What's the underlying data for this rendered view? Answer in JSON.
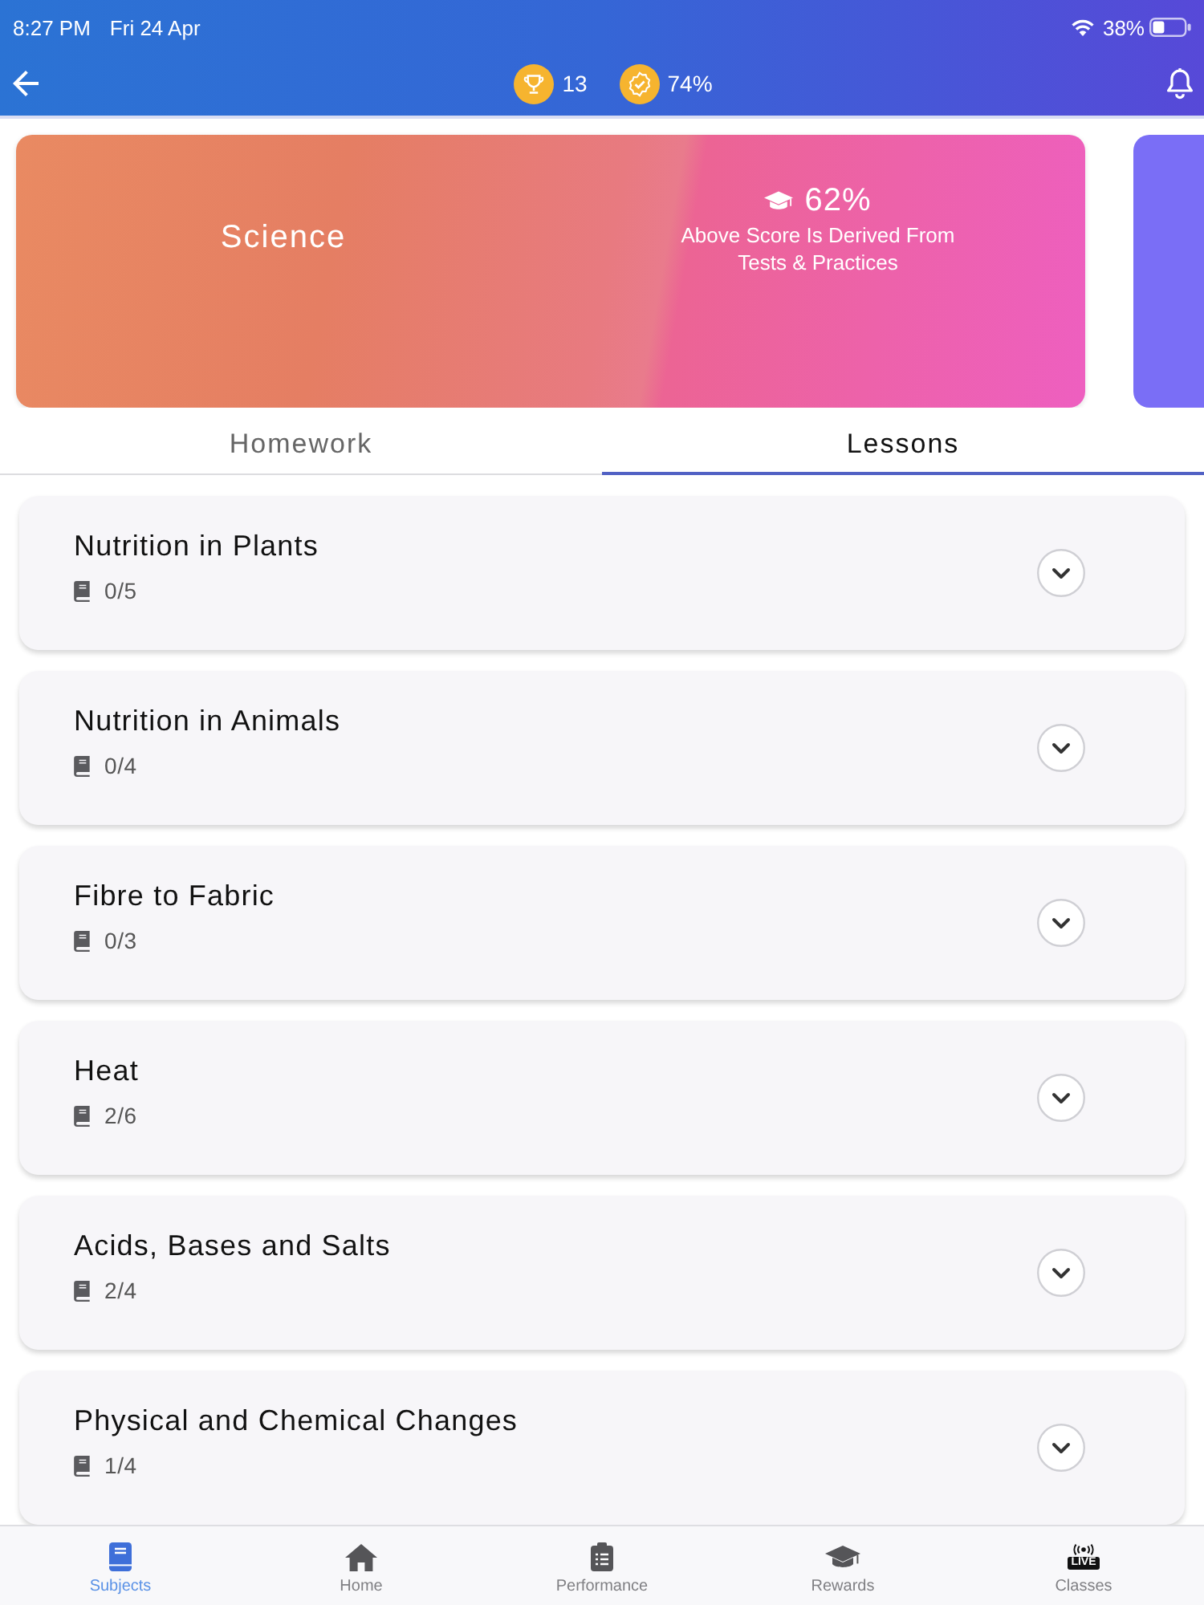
{
  "status_bar": {
    "time": "8:27 PM",
    "date": "Fri 24 Apr",
    "battery": "38%"
  },
  "header": {
    "trophies": "13",
    "score": "74%"
  },
  "carousel": {
    "cards": [
      {
        "title": "Science",
        "score": "62%",
        "note": "Above Score Is Derived From Tests & Practices"
      }
    ],
    "has_next": true
  },
  "tabs": [
    {
      "label": "Homework",
      "selected": false
    },
    {
      "label": "Lessons",
      "selected": true
    }
  ],
  "lessons": [
    {
      "title": "Nutrition in Plants",
      "progress": "0/5",
      "expanded": false
    },
    {
      "title": "Nutrition in Animals",
      "progress": "0/4",
      "expanded": false
    },
    {
      "title": "Fibre to Fabric",
      "progress": "0/3",
      "expanded": false
    },
    {
      "title": "Heat",
      "progress": "2/6",
      "expanded": false
    },
    {
      "title": "Acids, Bases and Salts",
      "progress": "2/4",
      "expanded": false
    },
    {
      "title": "Physical and Chemical Changes",
      "progress": "1/4",
      "expanded": false
    }
  ],
  "bottom_nav": [
    {
      "label": "Subjects",
      "selected": true
    },
    {
      "label": "Home",
      "selected": false
    },
    {
      "label": "Performance",
      "selected": false
    },
    {
      "label": "Rewards",
      "selected": false
    },
    {
      "label": "Classes",
      "selected": false,
      "icon_label": "LIVE"
    }
  ]
}
